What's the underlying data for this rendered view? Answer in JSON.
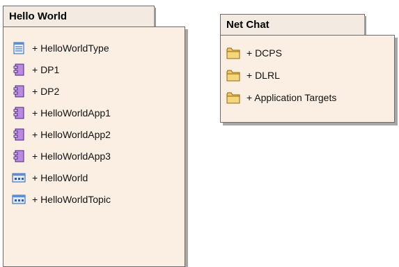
{
  "packages": [
    {
      "title": "Hello World",
      "items": [
        {
          "label": "+ HelloWorldType",
          "icon": "datatype-icon"
        },
        {
          "label": "+ DP1",
          "icon": "component-icon"
        },
        {
          "label": "+ DP2",
          "icon": "component-icon"
        },
        {
          "label": "+ HelloWorldApp1",
          "icon": "component-icon"
        },
        {
          "label": "+ HelloWorldApp2",
          "icon": "component-icon"
        },
        {
          "label": "+ HelloWorldApp3",
          "icon": "component-icon"
        },
        {
          "label": "+ HelloWorld",
          "icon": "topic-icon"
        },
        {
          "label": "+ HelloWorldTopic",
          "icon": "topic-icon"
        }
      ]
    },
    {
      "title": "Net Chat",
      "items": [
        {
          "label": "+ DCPS",
          "icon": "folder-icon"
        },
        {
          "label": "+ DLRL",
          "icon": "folder-icon"
        },
        {
          "label": "+ Application Targets",
          "icon": "folder-icon"
        }
      ]
    }
  ]
}
